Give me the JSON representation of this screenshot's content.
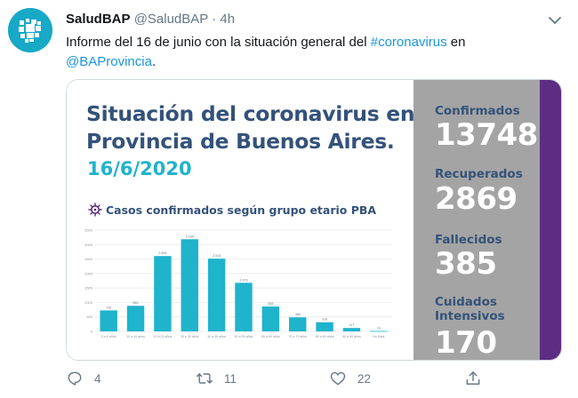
{
  "tweet": {
    "author_name": "SaludBAP",
    "author_handle": "@SaludBAP",
    "separator": "·",
    "time": "4h",
    "text_before": "Informe del 16 de junio con la situación general del ",
    "hashtag": "#coronavirus",
    "text_middle": " en",
    "mention": "@BAProvincia",
    "text_after": "."
  },
  "infographic": {
    "title_line1": "Situación del coronavirus en",
    "title_line2": "Provincia de Buenos Aires.",
    "date": "16/6/2020",
    "chart_heading": "Casos confirmados según grupo etario PBA",
    "stats": [
      {
        "label": "Confirmados",
        "value": "13748"
      },
      {
        "label": "Recuperados",
        "value": "2869"
      },
      {
        "label": "Fallecidos",
        "value": "385"
      },
      {
        "label_line1": "Cuidados",
        "label_line2": "Intensivos",
        "value": "170"
      }
    ],
    "colors": {
      "title": "#34527a",
      "date": "#1fb3cc",
      "bar": "#1fb3cc",
      "panel": "#a4a4a4",
      "stripe": "#5c2d82"
    }
  },
  "chart_data": {
    "type": "bar",
    "title": "Casos confirmados según grupo etario PBA",
    "categories": [
      "0 a 9 años",
      "10 a 19 años",
      "20 a 29 años",
      "30 a 39 años",
      "40 a 49 años",
      "50 a 59 años",
      "60 a 69 años",
      "70 a 79 años",
      "80 a 89 años",
      "90 a 99 años",
      "No Data"
    ],
    "values": [
      725,
      883,
      2604,
      3185,
      2513,
      1679,
      859,
      485,
      316,
      117,
      14
    ],
    "ylim": [
      0,
      3500
    ],
    "ytick_labels": [
      "0",
      "500",
      "1000",
      "1500",
      "2000",
      "2500",
      "3000",
      "3500"
    ],
    "grid": true,
    "legend": "none"
  },
  "actions": {
    "reply_count": "4",
    "retweet_count": "11",
    "like_count": "22"
  },
  "icons": [
    "reply-icon",
    "retweet-icon",
    "like-icon",
    "share-icon",
    "chevron-down-icon",
    "virus-icon"
  ]
}
